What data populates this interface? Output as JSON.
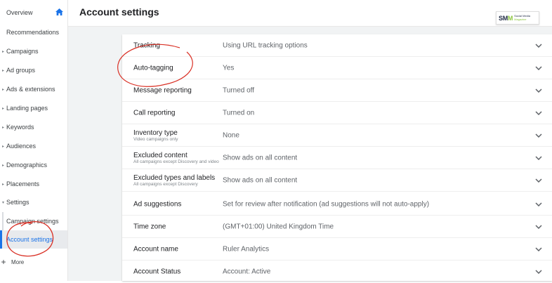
{
  "sidebar": {
    "items": [
      {
        "label": "Overview"
      },
      {
        "label": "Recommendations"
      },
      {
        "label": "Campaigns"
      },
      {
        "label": "Ad groups"
      },
      {
        "label": "Ads & extensions"
      },
      {
        "label": "Landing pages"
      },
      {
        "label": "Keywords"
      },
      {
        "label": "Audiences"
      },
      {
        "label": "Demographics"
      },
      {
        "label": "Placements"
      },
      {
        "label": "Settings"
      },
      {
        "label": "Campaign settings"
      },
      {
        "label": "Account settings"
      }
    ],
    "more_label": "More",
    "home_icon": "home-icon",
    "active_color": "#1a73e8"
  },
  "header": {
    "title": "Account settings"
  },
  "logo": {
    "main_s": "S",
    "main_m1": "M",
    "main_m2": "M",
    "line1": "Social Media",
    "line2": "Magazine"
  },
  "settings": {
    "rows": [
      {
        "label": "Tracking",
        "sub": "",
        "value": "Using URL tracking options"
      },
      {
        "label": "Auto-tagging",
        "sub": "",
        "value": "Yes"
      },
      {
        "label": "Message reporting",
        "sub": "",
        "value": "Turned off"
      },
      {
        "label": "Call reporting",
        "sub": "",
        "value": "Turned on"
      },
      {
        "label": "Inventory type",
        "sub": "Video campaigns only",
        "value": "None"
      },
      {
        "label": "Excluded content",
        "sub": "All campaigns except Discovery and video",
        "value": "Show ads on all content"
      },
      {
        "label": "Excluded types and labels",
        "sub": "All campaigns except Discovery",
        "value": "Show ads on all content"
      },
      {
        "label": "Ad suggestions",
        "sub": "",
        "value": "Set for review after notification (ad suggestions will not auto-apply)"
      },
      {
        "label": "Time zone",
        "sub": "",
        "value": "(GMT+01:00) United Kingdom Time"
      },
      {
        "label": "Account name",
        "sub": "",
        "value": "Ruler Analytics"
      },
      {
        "label": "Account Status",
        "sub": "",
        "value": "Account: Active"
      }
    ]
  },
  "annotation_color": "#d93025"
}
